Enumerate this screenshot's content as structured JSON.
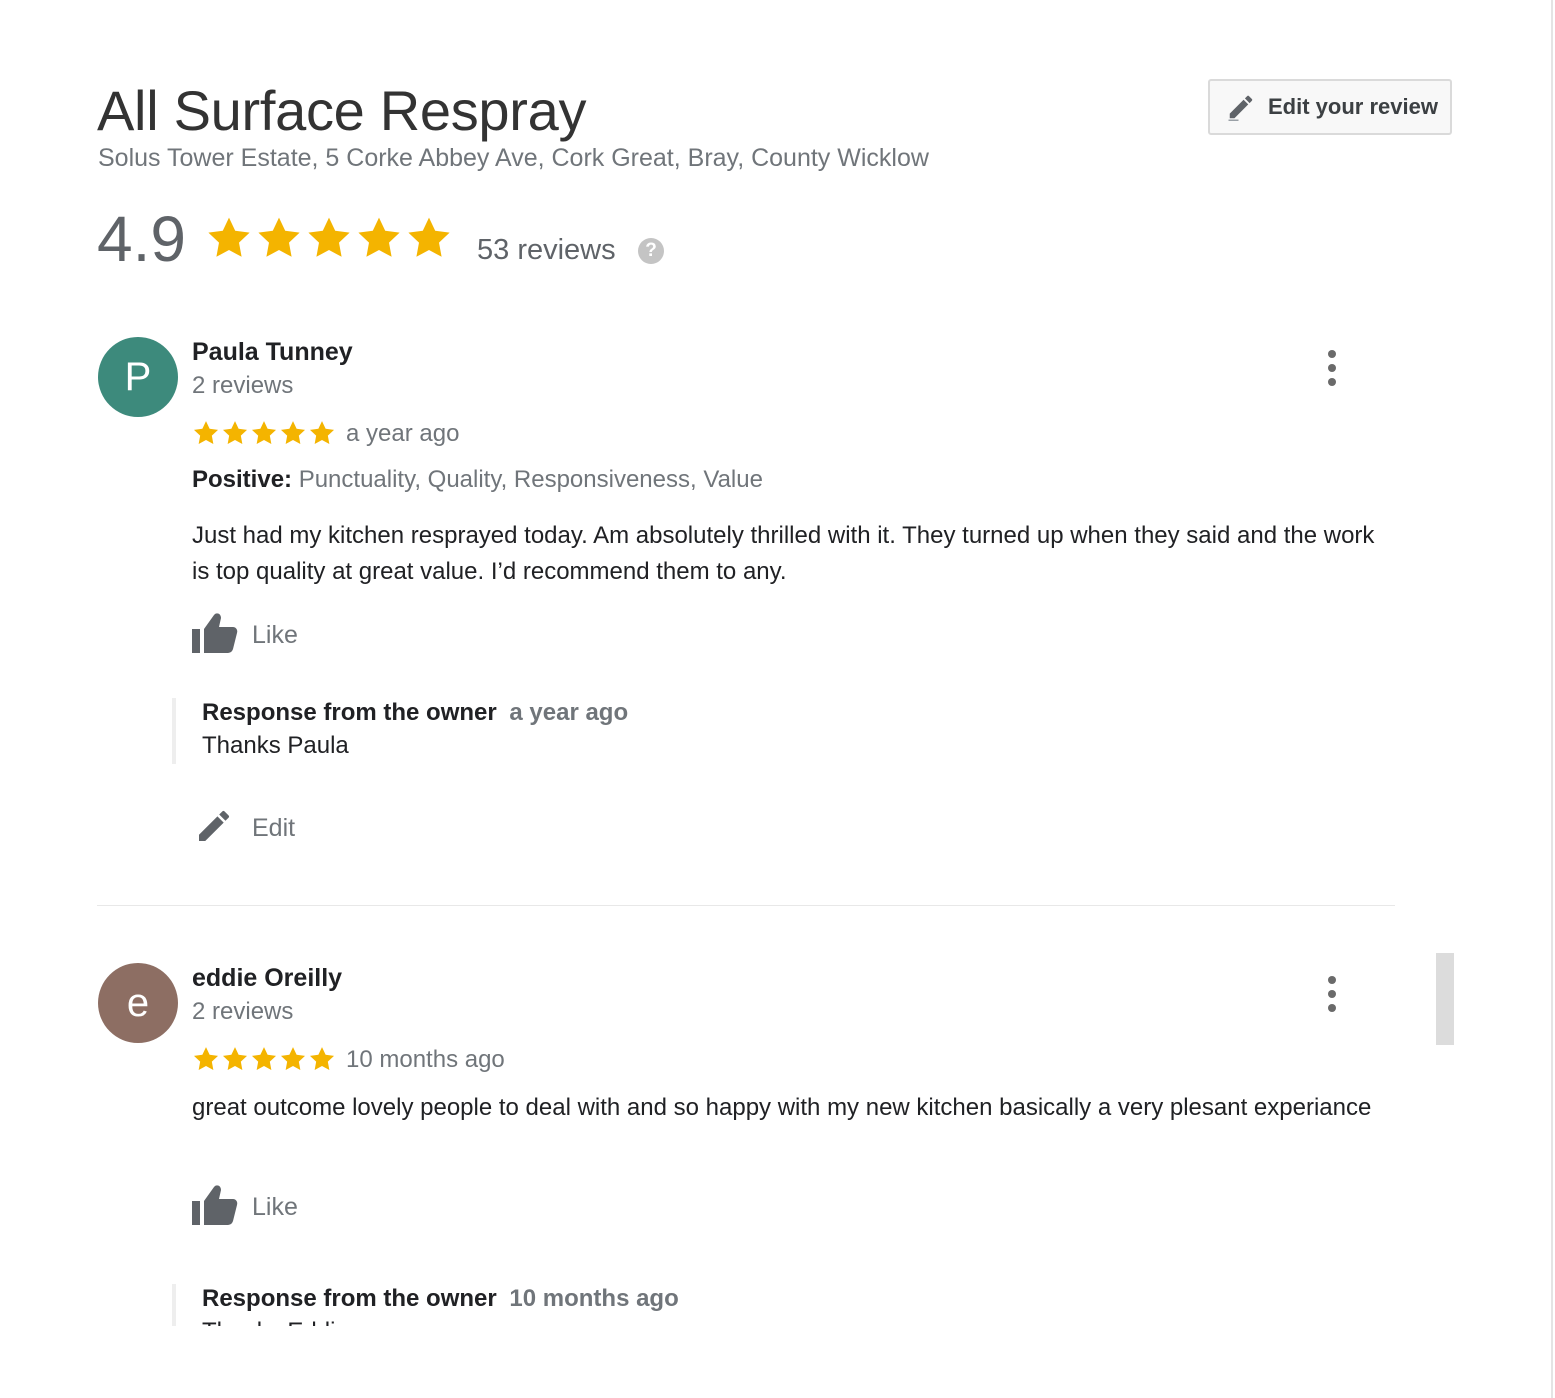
{
  "business": {
    "name": "All Surface Respray",
    "address": "Solus Tower Estate, 5 Corke Abbey Ave, Cork Great, Bray, County Wicklow",
    "rating": "4.9",
    "stars": 5,
    "reviews_count": "53 reviews",
    "help_symbol": "?"
  },
  "edit_review_button": {
    "label": "Edit your review",
    "icon": "pencil-icon"
  },
  "colors": {
    "star": "#f4b400",
    "avatar_p": "#3d8a7c",
    "avatar_e": "#8d6e63"
  },
  "reviews": [
    {
      "avatar_letter": "P",
      "name": "Paula Tunney",
      "review_count": "2 reviews",
      "stars": 5,
      "date": "a year ago",
      "positive_label": "Positive:",
      "positive_values": "Punctuality, Quality, Responsiveness, Value",
      "text": "Just had my kitchen resprayed today. Am absolutely thrilled with it. They turned up when they said and the work is top quality at great value. I’d recommend them to any.",
      "like_label": "Like",
      "owner_response": {
        "label": "Response from the owner",
        "date": "a year ago",
        "text": "Thanks Paula"
      },
      "edit_label": "Edit"
    },
    {
      "avatar_letter": "e",
      "name": "eddie Oreilly",
      "review_count": "2 reviews",
      "stars": 5,
      "date": "10 months ago",
      "text": "great outcome lovely people to deal with and so happy with my new kitchen basically  a very plesant experiance",
      "like_label": "Like",
      "owner_response": {
        "label": "Response from the owner",
        "date": "10 months ago",
        "text": "Thanks Eddie"
      }
    }
  ]
}
